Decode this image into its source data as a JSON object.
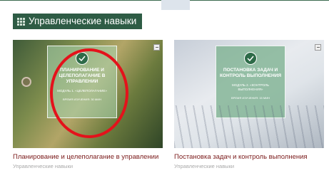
{
  "section": {
    "title": "Управленческие навыки",
    "accent": "#2e5c45"
  },
  "cards": [
    {
      "poster_title": "Планирование и целеполагание в управлении",
      "poster_module": "Модуль 1. «Целеполагание»",
      "poster_time": "Время изучения: 30 мин",
      "title": "Планирование и целеполагание в управлении",
      "category": "Управленческие навыки"
    },
    {
      "poster_title": "Постановка задач и контроль выполнения",
      "poster_module": "Модуль 2. «Контроль выполнения»",
      "poster_time": "Время изучения: 15 мин",
      "title": "Постановка задач и контроль выполнения",
      "category": "Управленческие навыки"
    }
  ],
  "annotation_color": "#e4121b"
}
